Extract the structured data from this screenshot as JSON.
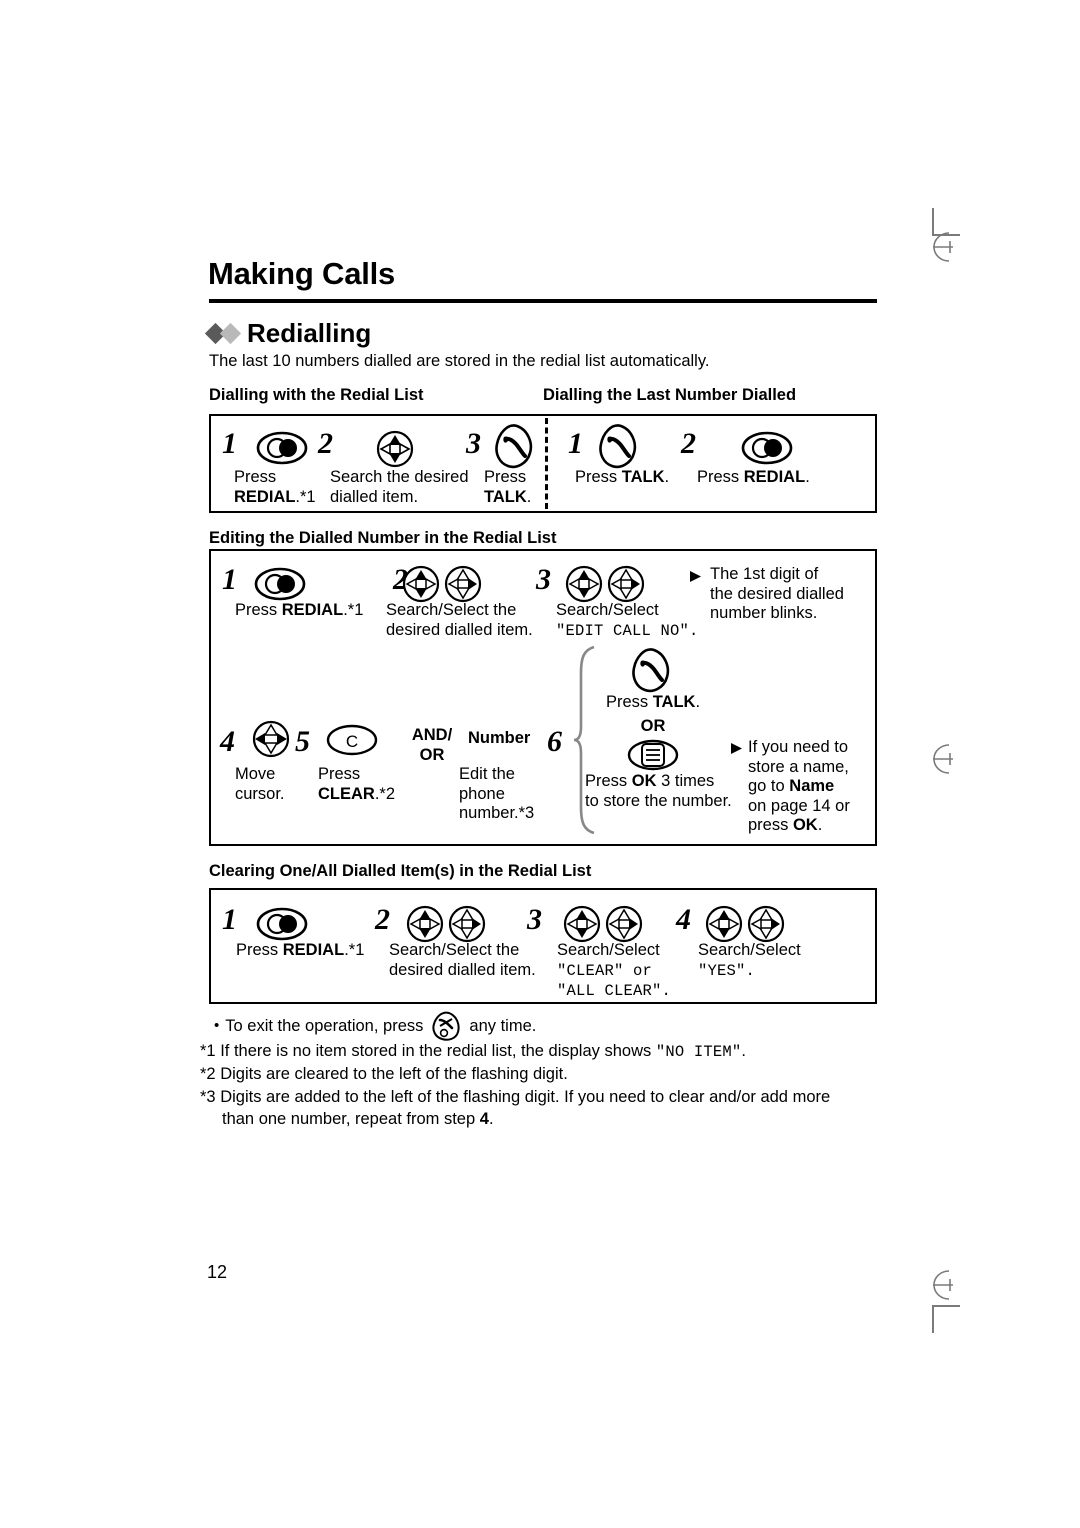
{
  "page": {
    "chapter_title": "Making Calls",
    "section_title": "Redialling",
    "intro": "The last 10 numbers dialled are stored in the redial list automatically.",
    "page_number": "12"
  },
  "group_redial": {
    "left_heading": "Dialling with the Redial List",
    "right_heading": "Dialling the Last Number Dialled",
    "left_steps": [
      {
        "num": "1",
        "icon": "redial-button-icon",
        "line1": "Press",
        "line1_bold": "",
        "line2_bold": "REDIAL",
        "line2_tail": ".*1"
      },
      {
        "num": "2",
        "icon": "navigator-updown-icon",
        "line1": "Search the desired",
        "line2": "dialled item."
      },
      {
        "num": "3",
        "icon": "talk-button-icon",
        "line1": "Press",
        "line2_bold": "TALK",
        "line2_tail": "."
      }
    ],
    "right_steps": [
      {
        "num": "1",
        "icon": "talk-button-icon",
        "prefix": "Press ",
        "bold": "TALK",
        "suffix": "."
      },
      {
        "num": "2",
        "icon": "redial-button-icon",
        "prefix": "Press ",
        "bold": "REDIAL",
        "suffix": "."
      }
    ]
  },
  "group_editing": {
    "heading": "Editing the Dialled Number in the Redial List",
    "step1": {
      "num": "1",
      "icon": "redial-button-icon",
      "prefix": "Press ",
      "bold": "REDIAL",
      "suffix": ".*1"
    },
    "step2": {
      "num": "2",
      "icon": "navigator-pair-search-select-icon",
      "line1": "Search/Select the",
      "line2": "desired dialled item."
    },
    "step3": {
      "num": "3",
      "icon": "navigator-pair-search-select-icon",
      "line1": "Search/Select",
      "line2_mono": "\"EDIT CALL NO\"."
    },
    "note1": {
      "line1": "The 1st digit of",
      "line2": "the desired dialled",
      "line3": "number blinks."
    },
    "step4": {
      "num": "4",
      "icon": "navigator-leftright-icon",
      "line1": "Move",
      "line2": "cursor."
    },
    "step5": {
      "num": "5",
      "icon": "clear-button-icon",
      "line1": "Press",
      "line2_bold": "CLEAR",
      "line2_tail": ".*2"
    },
    "connector": {
      "line1": "AND/",
      "line2": "OR"
    },
    "number_block": {
      "heading": "Number",
      "line1": "Edit the",
      "line2": "phone",
      "line3": "number.*3"
    },
    "step6": {
      "num": "6",
      "talk_icon": "talk-button-icon",
      "talk_caption_prefix": "Press ",
      "talk_caption_bold": "TALK",
      "talk_caption_suffix": ".",
      "or_label": "OR",
      "ok_icon": "ok-menu-button-icon",
      "ok_line1_prefix": "Press ",
      "ok_line1_bold": "OK",
      "ok_line1_suffix": " 3 times",
      "ok_line2": "to store the number."
    },
    "note2": {
      "line1": "If you need to",
      "line2": "store a name,",
      "line3_prefix": "go to ",
      "line3_bold": "Name",
      "line4": "on page 14 or",
      "line5_prefix": "press ",
      "line5_bold": "OK",
      "line5_suffix": "."
    }
  },
  "group_clearing": {
    "heading": "Clearing One/All Dialled Item(s) in the Redial List",
    "steps": [
      {
        "num": "1",
        "icon": "redial-button-icon",
        "prefix": "Press ",
        "bold": "REDIAL",
        "suffix": ".*1"
      },
      {
        "num": "2",
        "icon": "navigator-pair-search-select-icon",
        "line1": "Search/Select the",
        "line2": "desired dialled item."
      },
      {
        "num": "3",
        "icon": "navigator-pair-search-select-icon",
        "line1": "Search/Select",
        "line2_mono": "\"CLEAR\" or",
        "line3_mono": "\"ALL CLEAR\"."
      },
      {
        "num": "4",
        "icon": "navigator-pair-search-select-icon",
        "line1": "Search/Select",
        "line2_mono": "\"YES\"."
      }
    ]
  },
  "footnotes": {
    "bullet": {
      "prefix": "To exit the operation, press",
      "icon": "off-button-icon",
      "suffix": "any time."
    },
    "n1_label": "*1",
    "n1_a": "If there is no item stored in the redial list, the display shows ",
    "n1_mono": "\"NO ITEM\"",
    "n1_b": ".",
    "n2_label": "*2",
    "n2_text": "Digits are cleared to the left of the flashing digit.",
    "n3_label": "*3",
    "n3_a": "Digits are added to the left of the flashing digit. If you need to clear and/or add more",
    "n3_b_prefix": "than one number, repeat from step ",
    "n3_b_bold": "4",
    "n3_b_suffix": "."
  },
  "colors": {
    "ink": "#000000",
    "diamond_dark": "#5a5a5a",
    "diamond_light": "#b9b9b9",
    "regmark": "#7a7a7a"
  }
}
